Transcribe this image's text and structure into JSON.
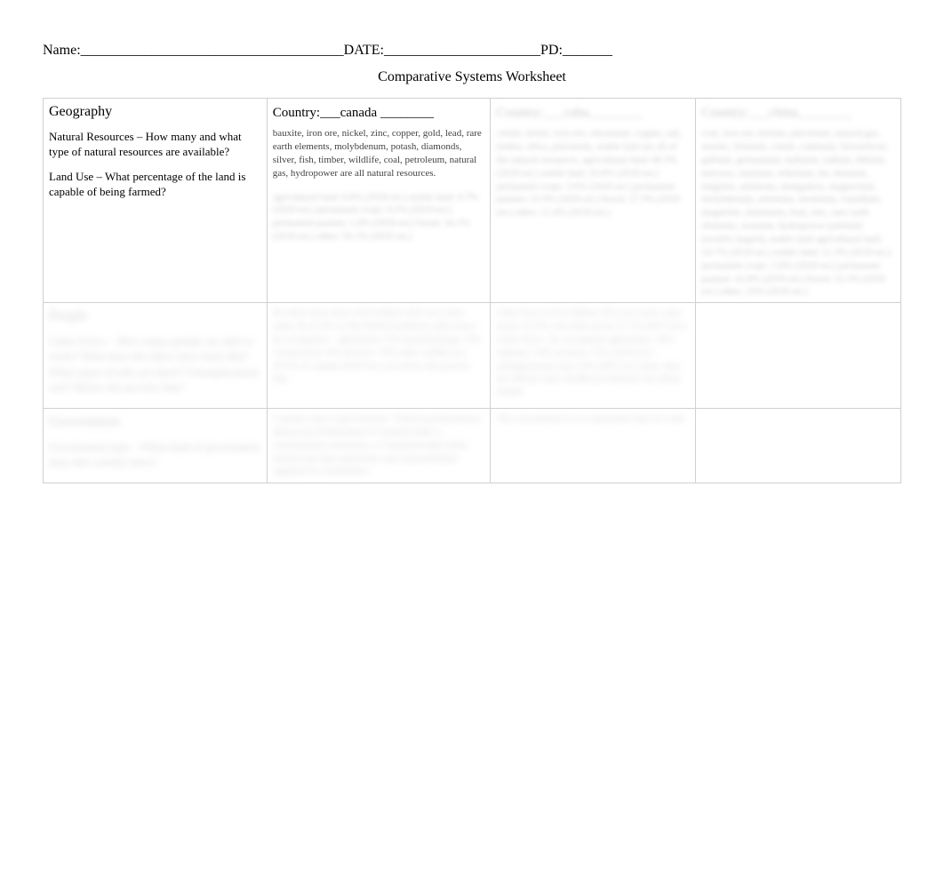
{
  "header": {
    "name_label": "Name:",
    "name_line": "_____________________________________",
    "date_label": "DATE:",
    "date_line": "______________________",
    "pd_label": "PD:",
    "pd_line": "_______"
  },
  "title": "Comparative Systems Worksheet",
  "rows": {
    "geography": {
      "heading": "Geography",
      "natural_resources_label": "Natural Resources",
      "natural_resources_q": " – How many and what type of natural resources are available?",
      "land_use_label": "Land Use",
      "land_use_q": " – What percentage of the land is capable of being farmed?",
      "country_a_label": "Country:___canada ________",
      "country_a_answer": "bauxite, iron ore, nickel, zinc, copper, gold, lead, rare earth elements, molybdenum, potash, diamonds, silver, fish, timber, wildlife, coal, petroleum, natural gas, hydropower are all natural resources.",
      "country_a_blurred": "agricultural land:   6.8% (2018 est.) arable land: 4.7% (2018 est.) permanent crops: 0.5% (2018 est.) permanent pasture: 1.6% (2018 est.) forest:   34.1% (2018 est.) other:   59.1% (2018 est.)",
      "country_b_header": "Country:___cuba________",
      "country_b_blurred": "cobalt, nickel, iron ore, chromium, copper, salt, timber, silica, petroleum, arable land are all of the natural resources.\n\nagricultural land:   60.3% (2018 est.) arable land: 33.8% (2018 est.) permanent crops: 3.6% (2018 est.) permanent pasture: 22.9% (2018 est.) forest:   27.3% (2018 est.) other:   12.4% (2018 est.)",
      "country_c_header": "Country:___china________",
      "country_c_blurred": "coal, iron ore, helium, petroleum, natural gas, arsenic, bismuth, cobalt, cadmium, ferrosilicon, gallium, germanium, hafnium, indium, lithium, mercury, tantalum, tellurium, tin, titanium, tungsten, antimony, manganese, magnesium, molybdenum, selenium, strontium, vanadium, magnetite, aluminum, lead, zinc, rare earth elements, uranium, hydropower potential (world's largest), arable land\n\nagricultural land:   54.7% (2018 est.) arable land: 11.3% (2018 est.) permanent crops: 1.6% (2018 est.) permanent pasture: 41.8% (2018 est.) forest:   22.3% (2018 est.) other:   23% (2018 est.)"
    },
    "people": {
      "heading": "People",
      "labels_blurred": "Labor Force – How many people are able to work? What does the labor force look like? What types of jobs are there? Unemployment rate? Below the poverty line?",
      "a": "the labor force faces     20.8 million\n2021 est.)\nnote:   ranks 30 of 231 in The World Factbook\nLabor force - by occupation – agriculture:    2% manufacturing:    13% construction:    6% services:    76% other:    (2006 est.)\n10.3% of canada (2019 est.) are below the poverty line",
      "b": "Labor force    4.515 million\n2021 est.)\nnote:   state sector 72.3%, non-state sector 27.7% (2017 est.)\nLabor force - by occupation agriculture:    18% industry:    10% services:    72% (2016 est.)\nunemployment rate   2.6% (2021 est.)\nnote:   data are official rates; unofficial estimates are about double",
      "c": ""
    },
    "government": {
      "heading": "Government",
      "labels_blurred": "Government type – What kind of government does this country have?",
      "a": "Canada's type of government - Federal parliamentary democracy (Parliament of Canada) under a constitutional monarchy; a Commonwealth realm; federal and state authorities and responsibilities regulated in constitution",
      "b": "The Government Is A Communist State In Cuba",
      "c": ""
    }
  }
}
